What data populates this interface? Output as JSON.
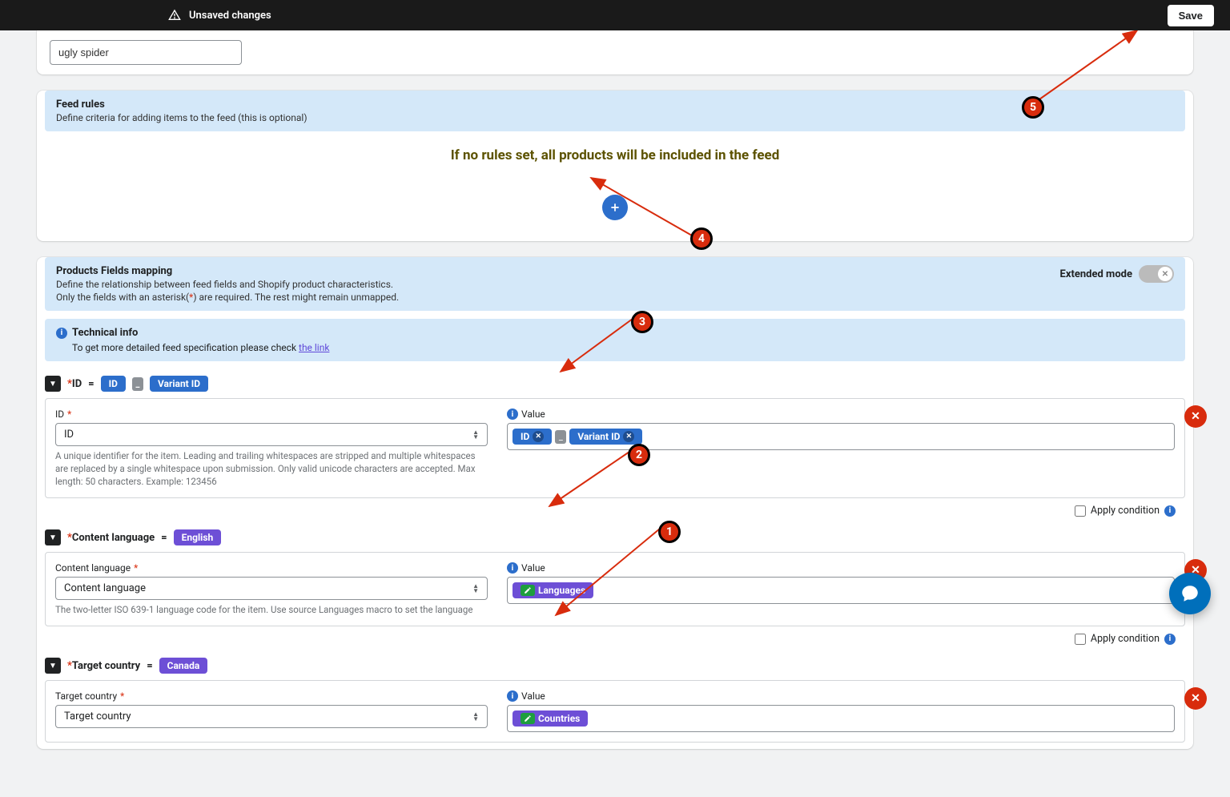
{
  "topbar": {
    "unsaved": "Unsaved changes",
    "save": "Save"
  },
  "feed_name_value": "ugly spider",
  "feed_rules": {
    "title": "Feed rules",
    "sub": "Define criteria for adding items to the feed (this is optional)",
    "empty": "If no rules set, all products will be included in the feed"
  },
  "pfm": {
    "title": "Products Fields mapping",
    "sub1": "Define the relationship between feed fields and Shopify product characteristics.",
    "sub2_a": "Only the fields with an asterisk(",
    "sub2_b": ") are required. The rest might remain unmapped.",
    "ext_mode": "Extended mode"
  },
  "tech": {
    "head": "Technical info",
    "body": "To get more detailed feed specification please check ",
    "link": "the link"
  },
  "rows": {
    "id": {
      "header_name": "ID",
      "tag1": "ID",
      "sep": "_",
      "tag2": "Variant ID",
      "field_label": "ID",
      "select_value": "ID",
      "help": "A unique identifier for the item. Leading and trailing whitespaces are stripped and multiple whitespaces are replaced by a single whitespace upon submission. Only valid unicode characters are accepted. Max length: 50 characters. Example: 123456",
      "value_label": "Value",
      "v_tag1": "ID",
      "v_sep": "_",
      "v_tag2": "Variant ID"
    },
    "lang": {
      "header_name": "Content language",
      "tag": "English",
      "field_label": "Content language",
      "select_value": "Content language",
      "help": "The two-letter ISO 639-1 language code for the item. Use source Languages macro to set the language",
      "value_label": "Value",
      "v_tag": "Languages"
    },
    "country": {
      "header_name": "Target country",
      "tag": "Canada",
      "field_label": "Target country",
      "select_value": "Target country",
      "value_label": "Value",
      "v_tag": "Countries"
    }
  },
  "apply_condition": "Apply condition",
  "markers": {
    "m1": "1",
    "m2": "2",
    "m3": "3",
    "m4": "4",
    "m5": "5"
  }
}
